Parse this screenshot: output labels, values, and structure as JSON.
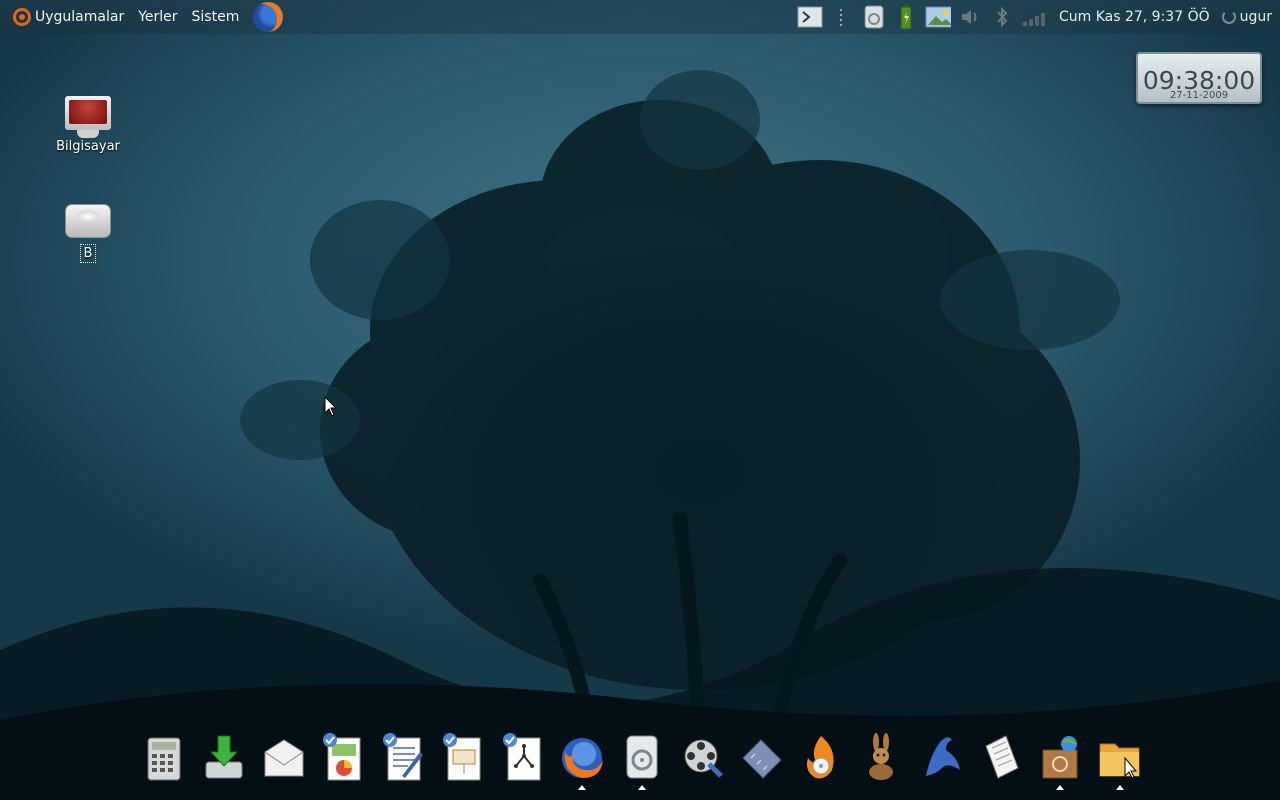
{
  "panel": {
    "menus": [
      "Uygulamalar",
      "Yerler",
      "Sistem"
    ],
    "clock_text": "Cum Kas 27,  9:37 ÖÖ",
    "username": "ugur"
  },
  "clock_widget": {
    "time": "09:38:00",
    "date": "27-11-2009"
  },
  "desktop": {
    "icons": [
      {
        "label": "Bilgisayar",
        "icon": "computer-icon"
      },
      {
        "label": "B",
        "icon": "drive-icon"
      }
    ]
  },
  "dock": {
    "items": [
      {
        "icon": "calculator-icon"
      },
      {
        "icon": "download-icon"
      },
      {
        "icon": "mail-icon"
      },
      {
        "icon": "spreadsheet-icon"
      },
      {
        "icon": "writer-icon"
      },
      {
        "icon": "presentation-icon"
      },
      {
        "icon": "diagram-icon"
      },
      {
        "icon": "firefox-icon",
        "running": true
      },
      {
        "icon": "disk-utility-icon",
        "running": true
      },
      {
        "icon": "media-player-icon"
      },
      {
        "icon": "ruler-icon"
      },
      {
        "icon": "burner-icon"
      },
      {
        "icon": "rabbit-icon"
      },
      {
        "icon": "bird-icon"
      },
      {
        "icon": "document-viewer-icon"
      },
      {
        "icon": "package-icon",
        "running": true
      },
      {
        "icon": "folder-icon",
        "running": true
      }
    ]
  },
  "colors": {
    "accent": "#e0661d",
    "panel_text": "#f2f6f8",
    "wallpaper": "#2c5a6e"
  }
}
